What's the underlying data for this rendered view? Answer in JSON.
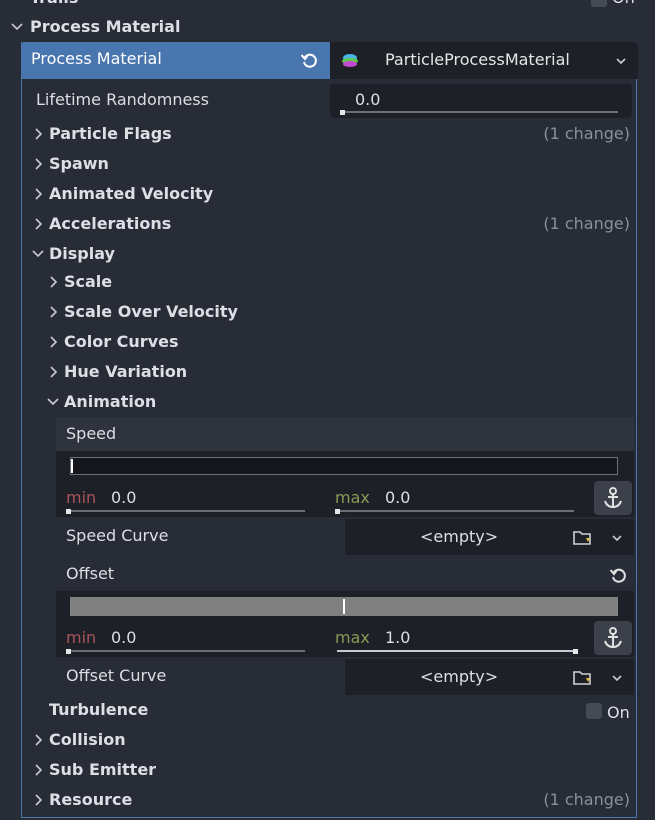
{
  "top": {
    "trails_label": "Trails",
    "trails_toggle": "On"
  },
  "section": {
    "title": "Process Material"
  },
  "material_header": {
    "label": "Process Material",
    "resource_name": "ParticleProcessMaterial"
  },
  "lifetime": {
    "label": "Lifetime Randomness",
    "value": "0.0"
  },
  "groups": {
    "particle_flags": {
      "label": "Particle Flags",
      "change": "(1 change)"
    },
    "spawn": {
      "label": "Spawn"
    },
    "animated_velocity": {
      "label": "Animated Velocity"
    },
    "accelerations": {
      "label": "Accelerations",
      "change": "(1 change)"
    },
    "display": {
      "label": "Display"
    },
    "turbulence": {
      "label": "Turbulence",
      "toggle": "On"
    },
    "collision": {
      "label": "Collision"
    },
    "sub_emitter": {
      "label": "Sub Emitter"
    },
    "resource": {
      "label": "Resource",
      "change": "(1 change)"
    }
  },
  "display_sub": {
    "scale": "Scale",
    "scale_over_velocity": "Scale Over Velocity",
    "color_curves": "Color Curves",
    "hue_variation": "Hue Variation",
    "animation": "Animation"
  },
  "animation": {
    "speed": {
      "label": "Speed",
      "min_label": "min",
      "min_value": "0.0",
      "max_label": "max",
      "max_value": "0.0",
      "min_fraction": 0.0,
      "max_fraction": 0.0
    },
    "speed_curve": {
      "label": "Speed Curve",
      "value": "<empty>"
    },
    "offset": {
      "label": "Offset",
      "min_label": "min",
      "min_value": "0.0",
      "max_label": "max",
      "max_value": "1.0",
      "min_fraction": 0.0,
      "max_fraction": 1.0
    },
    "offset_curve": {
      "label": "Offset Curve",
      "value": "<empty>"
    }
  },
  "colors": {
    "accent": "#4a76b0",
    "min_label": "#a8545a",
    "max_label": "#8a9a56"
  }
}
